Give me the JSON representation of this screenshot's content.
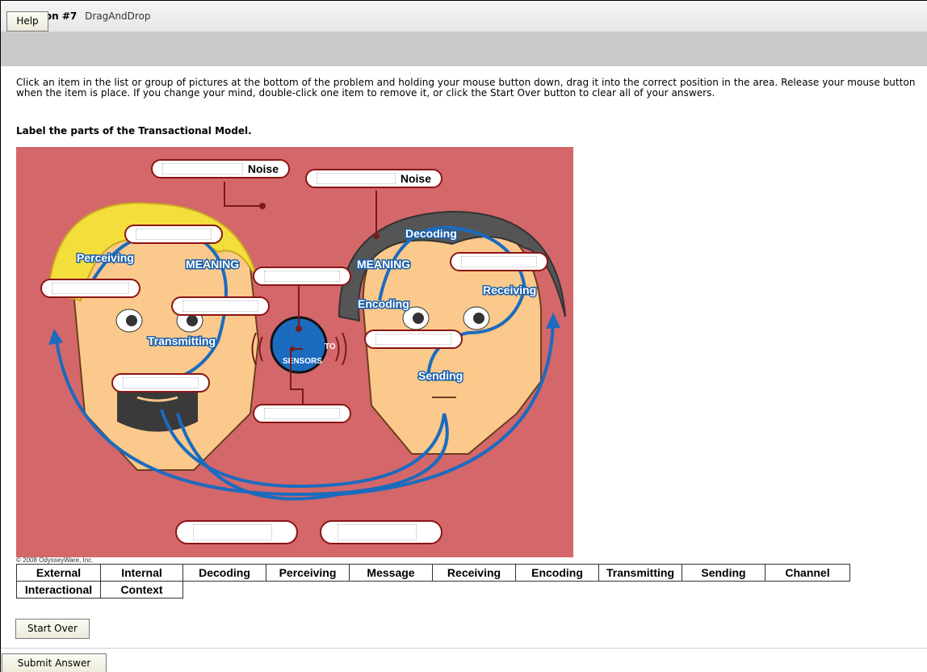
{
  "header": {
    "question_number": "Question #7",
    "question_type": "DragAndDrop"
  },
  "toolbar": {
    "help_label": "Help"
  },
  "instructions": "Click an item in the list or group of pictures at the bottom of the problem and holding your mouse button down, drag it into the correct position in the area. Release your mouse button when the item is place. If you change your mind, double-click one item to remove it, or click the Start Over button to clear all of your answers.",
  "prompt": "Label the parts of the Transactional Model.",
  "diagram": {
    "noise_label_left": "Noise",
    "noise_label_right": "Noise",
    "left_labels": {
      "perceiving": "Perceiving",
      "meaning": "MEANING",
      "transmitting": "Transmitting"
    },
    "right_labels": {
      "decoding": "Decoding",
      "meaning": "MEANING",
      "receiving": "Receiving",
      "encoding": "Encoding",
      "sending": "Sending"
    },
    "center_labels": {
      "to": "TO",
      "sensors": "SENSORS"
    },
    "copyright": "© 2008 OdysseyWare, Inc."
  },
  "word_bank": [
    "External",
    "Internal",
    "Decoding",
    "Perceiving",
    "Message",
    "Receiving",
    "Encoding",
    "Transmitting",
    "Sending",
    "Channel",
    "Interactional",
    "Context"
  ],
  "buttons": {
    "start_over": "Start Over",
    "submit": "Submit Answer"
  },
  "colors": {
    "diagram_bg": "#d4676a",
    "arrow_blue": "#1b6bbf",
    "slot_border": "#8b1515",
    "left_hair": "#f4de3c",
    "right_hair": "#555555",
    "skin": "#fbc98b"
  }
}
